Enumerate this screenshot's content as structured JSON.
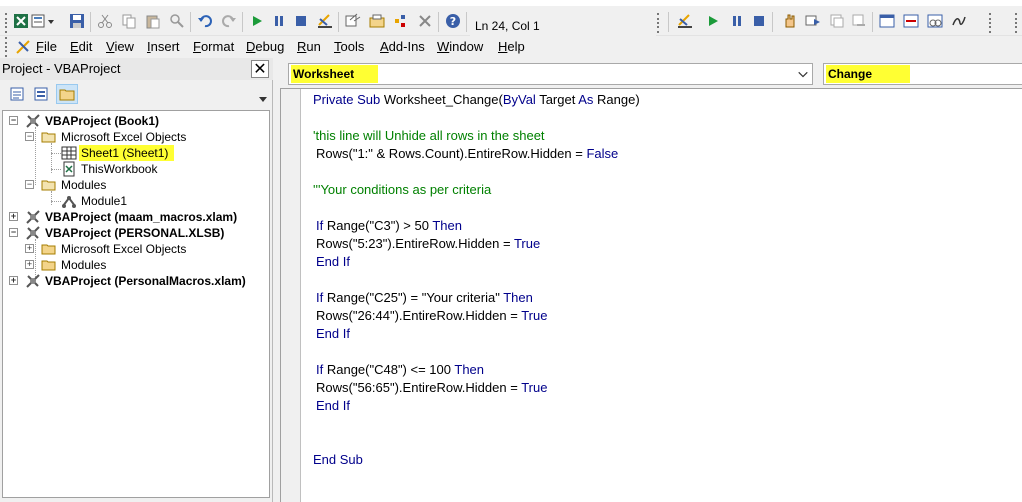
{
  "toolbar": {
    "position_text": "Ln 24, Col 1"
  },
  "menus": {
    "file": {
      "key": "F",
      "rest": "ile"
    },
    "edit": {
      "key": "E",
      "rest": "dit"
    },
    "view": {
      "key": "V",
      "rest": "iew"
    },
    "insert": {
      "key": "I",
      "rest": "nsert"
    },
    "format": {
      "key": "F",
      "rest": "ormat"
    },
    "debug": {
      "key": "D",
      "rest": "ebug"
    },
    "run": {
      "key": "R",
      "rest": "un"
    },
    "tools": {
      "key": "T",
      "rest": "ools"
    },
    "addins": {
      "key": "A",
      "rest": "dd-Ins"
    },
    "window": {
      "key": "W",
      "rest": "indow"
    },
    "help": {
      "key": "H",
      "rest": "elp"
    }
  },
  "project": {
    "title": "Project - VBAProject",
    "close_glyph": "✕",
    "tree": {
      "book1": "VBAProject (Book1)",
      "excel_objects_1": "Microsoft Excel Objects",
      "sheet1": "Sheet1 (Sheet1)",
      "thisworkbook": "ThisWorkbook",
      "modules_1": "Modules",
      "module1": "Module1",
      "maam": "VBAProject (maam_macros.xlam)",
      "personal": "VBAProject (PERSONAL.XLSB)",
      "excel_objects_2": "Microsoft Excel Objects",
      "modules_2": "Modules",
      "personalmacros": "VBAProject (PersonalMacros.xlam)"
    }
  },
  "code": {
    "object_combo": "Worksheet",
    "procedure_combo": "Change",
    "lines": [
      {
        "kw1": "Private Sub ",
        "t1": "Worksheet_Change(",
        "kw2": "ByVal",
        "t2": " Target ",
        "kw3": "As",
        "t3": " Range)"
      },
      {
        "cm": "'this line will Unhide all rows in the sheet"
      },
      {
        "t1": "Rows(\"1:\" & Rows.Count).EntireRow.Hidden = ",
        "kw1": "False"
      },
      {
        "cm": "'''Your conditions as per criteria"
      },
      {
        "kw1": "If",
        "t1": " Range(\"C3\") > 50 ",
        "kw2": "Then"
      },
      {
        "t1": "Rows(\"5:23\").EntireRow.Hidden = ",
        "kw1": "True"
      },
      {
        "kw1": "End If"
      },
      {
        "kw1": "If",
        "t1": " Range(\"C25\") = \"Your criteria\" ",
        "kw2": "Then"
      },
      {
        "t1": "Rows(\"26:44\").EntireRow.Hidden = ",
        "kw1": "True"
      },
      {
        "kw1": "End If"
      },
      {
        "kw1": "If",
        "t1": " Range(\"C48\") <= 100 ",
        "kw2": "Then"
      },
      {
        "t1": "Rows(\"56:65\").EntireRow.Hidden = ",
        "kw1": "True"
      },
      {
        "kw1": "End If"
      },
      {
        "kw1": "End Sub"
      }
    ]
  }
}
